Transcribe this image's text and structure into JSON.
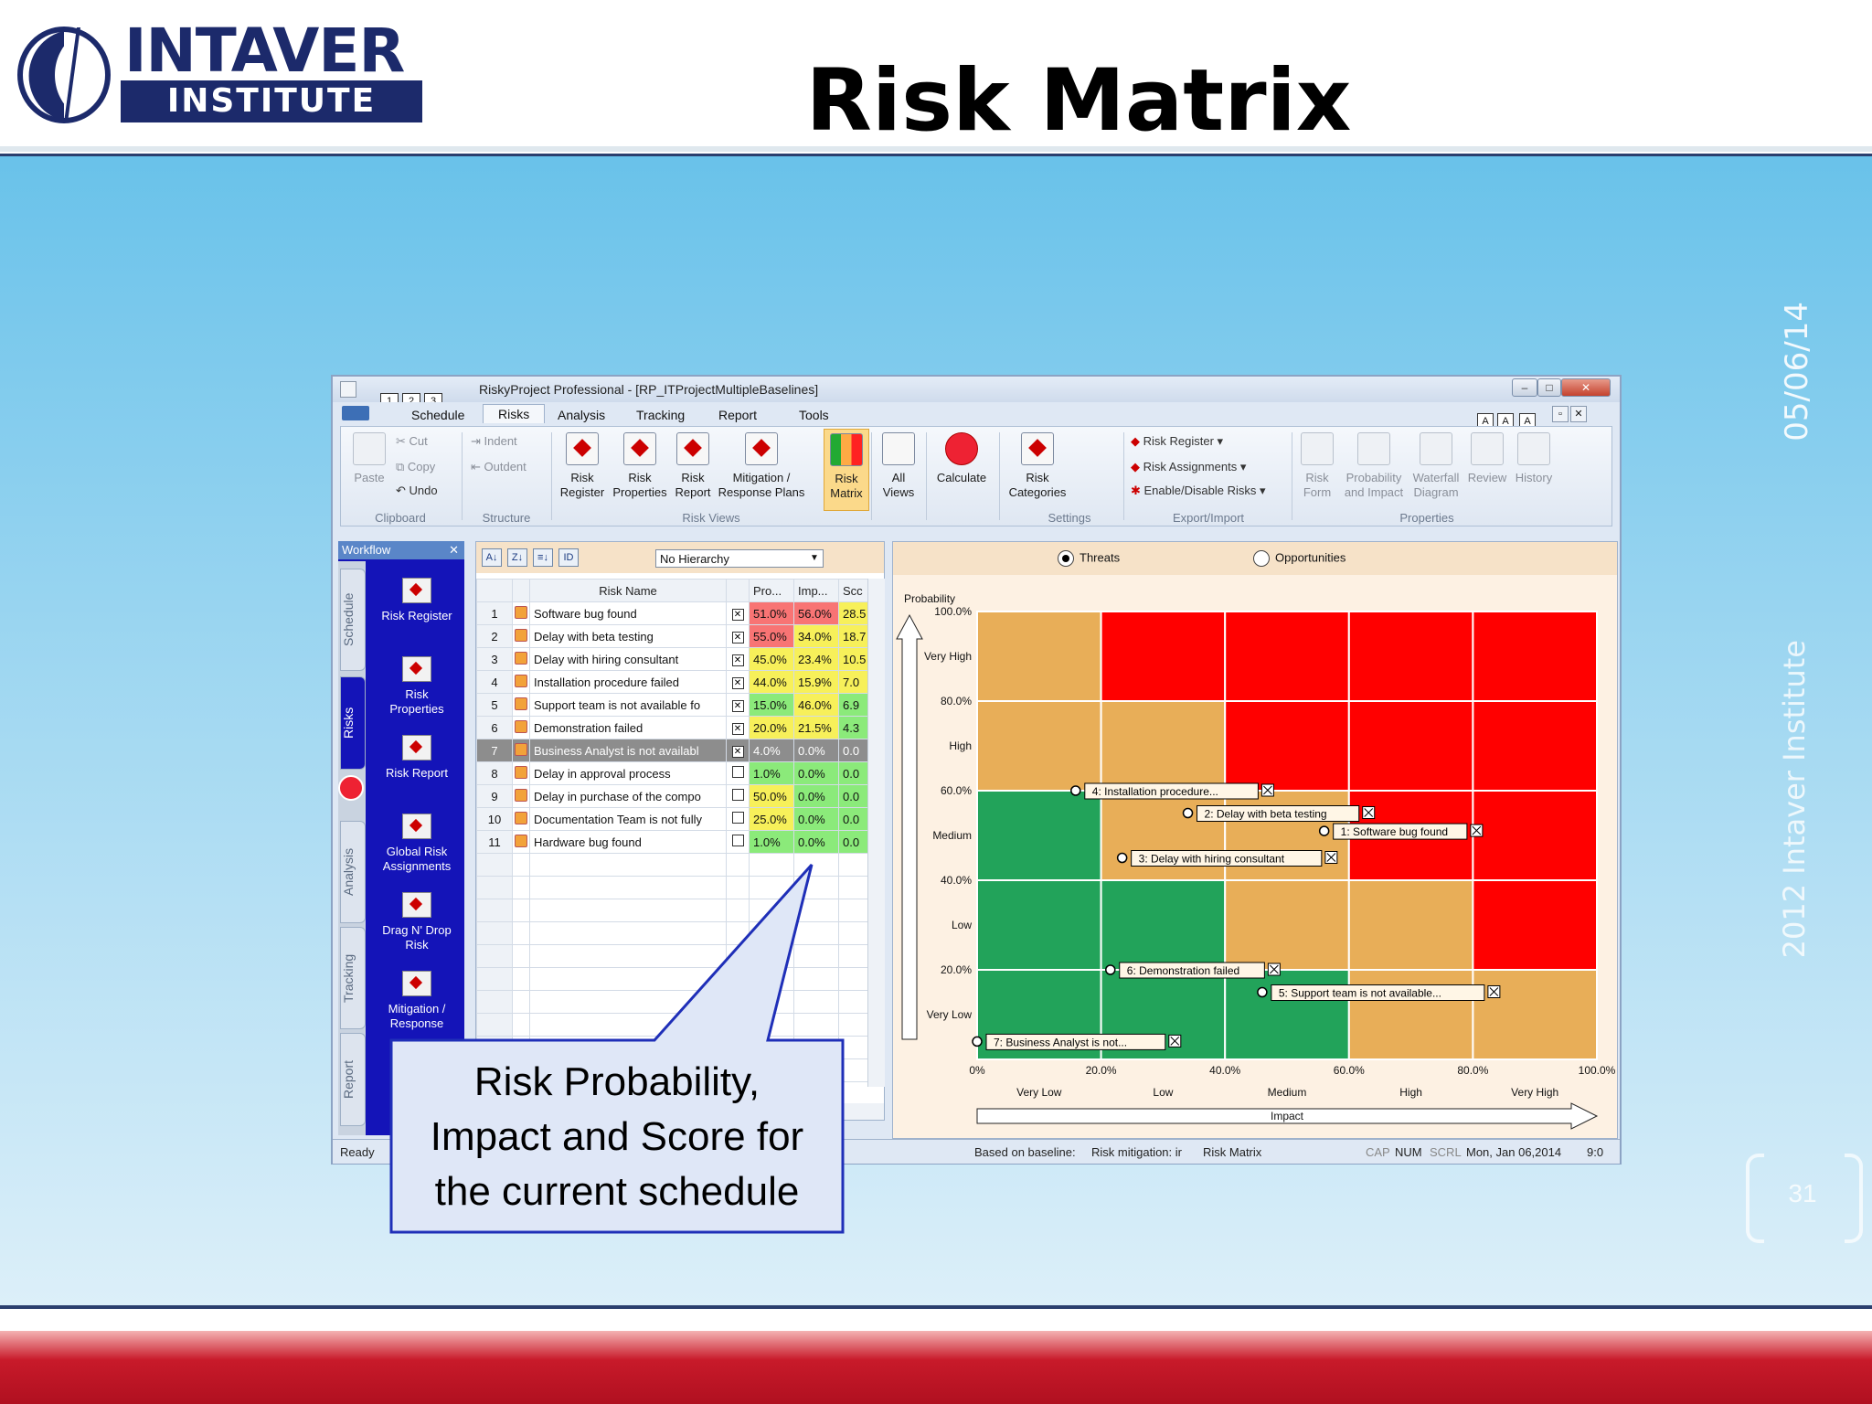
{
  "slide": {
    "logo_top": "INTAVER",
    "logo_bottom": "INSTITUTE",
    "title": "Risk Matrix",
    "date": "05/06/14",
    "copyright": "2012 Intaver Institute",
    "page_number": "31",
    "colors": {
      "panel_blue": "#69c2ea",
      "band_red": "#c81a2a",
      "logo_navy": "#1c2a6b"
    }
  },
  "app": {
    "window_title": "RiskyProject Professional - [RP_ITProjectMultipleBaselines]",
    "qat": [
      "1",
      "2",
      "3"
    ],
    "menu_tabs": [
      "Schedule",
      "Risks",
      "Analysis",
      "Tracking",
      "Report",
      "Tools"
    ],
    "active_tab": "Risks",
    "help_keys": [
      "A",
      "A",
      "A"
    ],
    "ribbon": {
      "clipboard": {
        "paste": "Paste",
        "cut": "Cut",
        "copy": "Copy",
        "undo": "Undo",
        "group": "Clipboard"
      },
      "structure": {
        "indent": "Indent",
        "outdent": "Outdent",
        "group": "Structure"
      },
      "risk_views": {
        "buttons": [
          {
            "l1": "Risk",
            "l2": "Register"
          },
          {
            "l1": "Risk",
            "l2": "Properties"
          },
          {
            "l1": "Risk",
            "l2": "Report"
          },
          {
            "l1": "Mitigation /",
            "l2": "Response Plans"
          },
          {
            "l1": "Risk",
            "l2": "Matrix"
          }
        ],
        "group": "Risk Views"
      },
      "all_views": {
        "l1": "All",
        "l2": "Views"
      },
      "calculate": "Calculate",
      "settings": {
        "l1": "Risk",
        "l2": "Categories",
        "group": "Settings"
      },
      "export": {
        "items": [
          "Risk Register",
          "Risk Assignments",
          "Enable/Disable Risks"
        ],
        "group": "Export/Import"
      },
      "properties": {
        "buttons": [
          {
            "l1": "Risk",
            "l2": "Form"
          },
          {
            "l1": "Probability",
            "l2": "and Impact"
          },
          {
            "l1": "Waterfall",
            "l2": "Diagram"
          },
          {
            "l1": "Review",
            "l2": ""
          },
          {
            "l1": "History",
            "l2": ""
          }
        ],
        "group": "Properties"
      }
    },
    "workflow": {
      "header": "Workflow",
      "tabs": [
        "Schedule",
        "Risks",
        "Analysis",
        "Tracking",
        "Report"
      ],
      "active": "Risks",
      "items": [
        {
          "l1": "Risk Register",
          "l2": ""
        },
        {
          "l1": "Risk",
          "l2": "Properties"
        },
        {
          "l1": "Risk Report",
          "l2": ""
        },
        {
          "l1": "Global Risk",
          "l2": "Assignments"
        },
        {
          "l1": "Drag N' Drop",
          "l2": "Risk"
        },
        {
          "l1": "Mitigation /",
          "l2": "Response"
        }
      ]
    },
    "grid": {
      "hierarchy": "No Hierarchy",
      "sort_buttons": [
        "A↓",
        "Z↓",
        "≡↓",
        "ID"
      ],
      "columns": [
        "Risk Name",
        "Pro...",
        "Imp...",
        "Scc"
      ],
      "rows": [
        {
          "n": "1",
          "name": "Software bug found",
          "checked": true,
          "p": "51.0%",
          "i": "56.0%",
          "s": "28.5",
          "pc": "red",
          "ic": "red",
          "sc": "yel"
        },
        {
          "n": "2",
          "name": "Delay with beta testing",
          "checked": true,
          "p": "55.0%",
          "i": "34.0%",
          "s": "18.7",
          "pc": "red",
          "ic": "yel",
          "sc": "yel"
        },
        {
          "n": "3",
          "name": "Delay with hiring consultant",
          "checked": true,
          "p": "45.0%",
          "i": "23.4%",
          "s": "10.5",
          "pc": "yel",
          "ic": "yel",
          "sc": "yel"
        },
        {
          "n": "4",
          "name": "Installation procedure failed",
          "checked": true,
          "p": "44.0%",
          "i": "15.9%",
          "s": "7.0",
          "pc": "yel",
          "ic": "yel",
          "sc": "yel"
        },
        {
          "n": "5",
          "name": "Support team is not available fo",
          "checked": true,
          "p": "15.0%",
          "i": "46.0%",
          "s": "6.9",
          "pc": "grn",
          "ic": "yel",
          "sc": "grn"
        },
        {
          "n": "6",
          "name": "Demonstration failed",
          "checked": true,
          "p": "20.0%",
          "i": "21.5%",
          "s": "4.3",
          "pc": "yel",
          "ic": "yel",
          "sc": "grn"
        },
        {
          "n": "7",
          "name": "Business Analyst is not availabl",
          "checked": true,
          "p": "4.0%",
          "i": "0.0%",
          "s": "0.0",
          "pc": "grn",
          "ic": "grn",
          "sc": "grn",
          "selected": true
        },
        {
          "n": "8",
          "name": "Delay in approval process",
          "checked": false,
          "p": "1.0%",
          "i": "0.0%",
          "s": "0.0",
          "pc": "grn",
          "ic": "grn",
          "sc": "grn"
        },
        {
          "n": "9",
          "name": "Delay in purchase of the compo",
          "checked": false,
          "p": "50.0%",
          "i": "0.0%",
          "s": "0.0",
          "pc": "yel",
          "ic": "grn",
          "sc": "grn"
        },
        {
          "n": "10",
          "name": "Documentation Team is not fully",
          "checked": false,
          "p": "25.0%",
          "i": "0.0%",
          "s": "0.0",
          "pc": "yel",
          "ic": "grn",
          "sc": "grn"
        },
        {
          "n": "11",
          "name": "Hardware bug found",
          "checked": false,
          "p": "1.0%",
          "i": "0.0%",
          "s": "0.0",
          "pc": "grn",
          "ic": "grn",
          "sc": "grn"
        }
      ]
    },
    "matrix": {
      "threats": "Threats",
      "opportunities": "Opportunities",
      "selected": "Threats",
      "prob_title": "Probability",
      "impact_title": "Impact",
      "y_ticks": [
        "100.0%",
        "80.0%",
        "60.0%",
        "40.0%",
        "20.0%"
      ],
      "y_bands": [
        "Very High",
        "High",
        "Medium",
        "Low",
        "Very Low"
      ],
      "x_ticks": [
        "0%",
        "20.0%",
        "40.0%",
        "60.0%",
        "80.0%",
        "100.0%"
      ],
      "x_bands": [
        "Very Low",
        "Low",
        "Medium",
        "High",
        "Very High"
      ],
      "cell_colors": [
        [
          "#e8ae58",
          "#ff0000",
          "#ff0000",
          "#ff0000",
          "#ff0000"
        ],
        [
          "#e8ae58",
          "#e8ae58",
          "#ff0000",
          "#ff0000",
          "#ff0000"
        ],
        [
          "#22a35a",
          "#e8ae58",
          "#e8ae58",
          "#ff0000",
          "#ff0000"
        ],
        [
          "#22a35a",
          "#22a35a",
          "#e8ae58",
          "#e8ae58",
          "#ff0000"
        ],
        [
          "#22a35a",
          "#22a35a",
          "#22a35a",
          "#e8ae58",
          "#e8ae58"
        ]
      ],
      "risks": [
        {
          "label": "4: Installation procedure...",
          "impact": 15.9,
          "prob": 60.0
        },
        {
          "label": "2: Delay with beta testing",
          "impact": 34.0,
          "prob": 55.0
        },
        {
          "label": "1: Software bug found",
          "impact": 56.0,
          "prob": 51.0
        },
        {
          "label": "3: Delay with hiring consultant",
          "impact": 23.4,
          "prob": 45.0
        },
        {
          "label": "6: Demonstration failed",
          "impact": 21.5,
          "prob": 20.0
        },
        {
          "label": "5: Support team is not available...",
          "impact": 46.0,
          "prob": 15.0
        },
        {
          "label": "7: Business Analyst is not...",
          "impact": 0.0,
          "prob": 4.0
        }
      ]
    },
    "status": {
      "ready": "Ready",
      "baseline": "Based on baseline:",
      "mitigation": "Risk mitigation: ir",
      "view": "Risk Matrix",
      "cap": "CAP",
      "num": "NUM",
      "scrl": "SCRL",
      "datetime": "Mon, Jan 06,2014",
      "time": "9:0"
    }
  },
  "callout": {
    "line1": "Risk Probability,",
    "line2": "Impact and Score for",
    "line3": "the current schedule"
  }
}
